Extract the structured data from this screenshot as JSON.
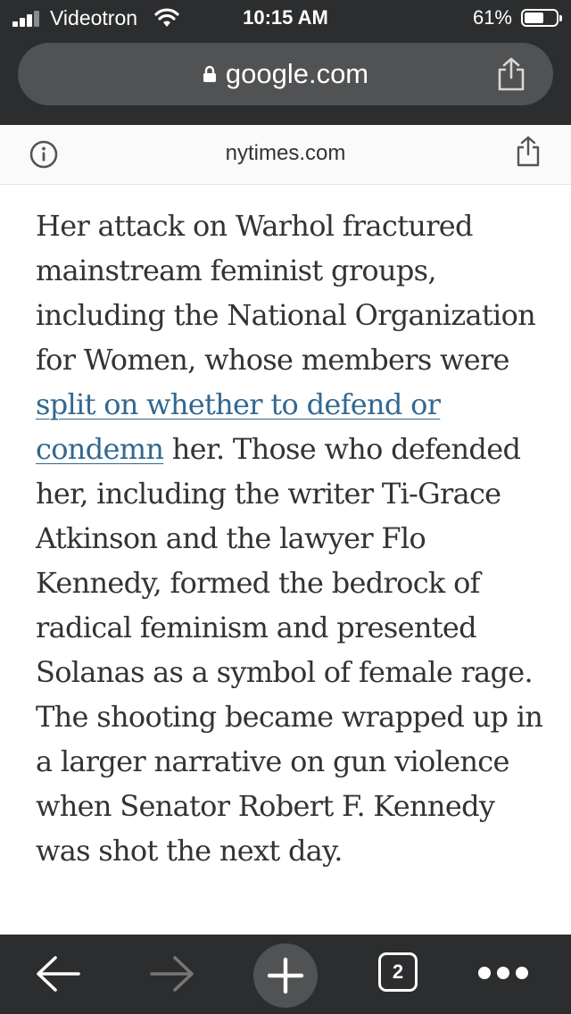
{
  "status_bar": {
    "carrier": "Videotron",
    "time": "10:15 AM",
    "battery_percent": "61%",
    "battery_level": 0.61,
    "icons": [
      "signal-icon",
      "wifi-icon",
      "battery-icon"
    ]
  },
  "url_bar": {
    "url": "google.com",
    "icons": [
      "lock-icon",
      "share-icon"
    ]
  },
  "site_header": {
    "domain": "nytimes.com",
    "icons": [
      "info-icon",
      "share-icon"
    ]
  },
  "article": {
    "before_link": "Her attack on Warhol fractured mainstream feminist groups, including the National Organization for Women, whose members were ",
    "link_text": "split on whether to defend or condemn",
    "after_link": " her. Those who defended her, including the writer Ti-Grace Atkinson and the lawyer Flo Kennedy, formed the bedrock of radical feminism and presented Solanas as a symbol of female rage. The shooting became wrapped up in a larger narrative on gun violence when Senator Robert F. Kennedy was shot the next day."
  },
  "toolbar": {
    "tab_count": "2",
    "icons": [
      "back-arrow-icon",
      "forward-arrow-icon",
      "plus-icon",
      "tabs-icon",
      "more-icon"
    ]
  },
  "colors": {
    "chrome": "#2b2d2f",
    "url_bar": "#505254",
    "link": "#326891",
    "text": "#333333"
  }
}
